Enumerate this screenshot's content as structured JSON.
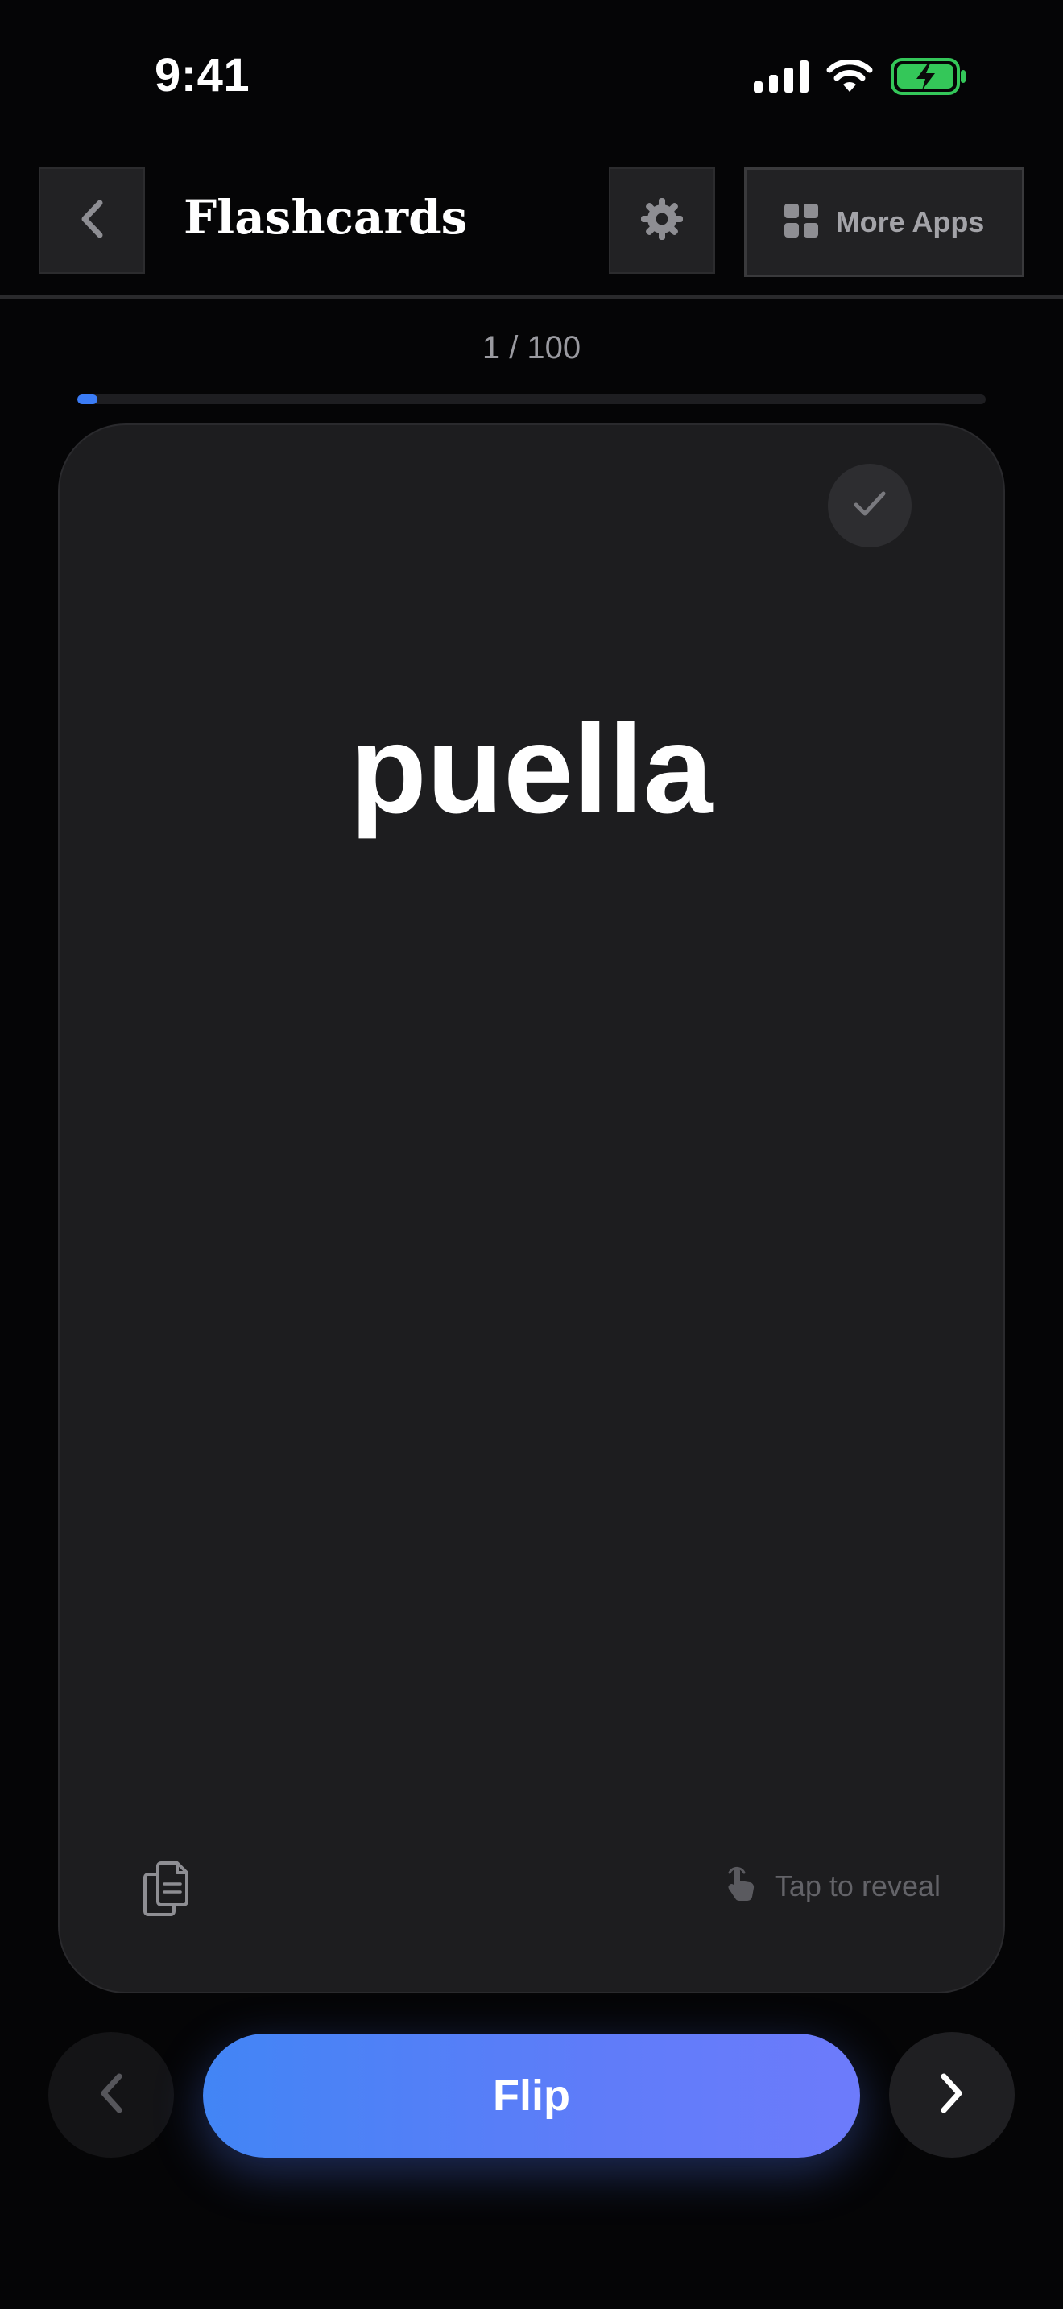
{
  "status_bar": {
    "time": "9:41",
    "icons": [
      "cellular-signal-icon",
      "wifi-icon",
      "battery-charging-icon"
    ],
    "battery_color": "#34c759"
  },
  "header": {
    "back_icon": "chevron-left-icon",
    "title": "Flashcards",
    "settings_icon": "gear-icon",
    "more_apps": {
      "icon": "grid-icon",
      "label": "More Apps"
    }
  },
  "progress": {
    "label": "1 / 100",
    "current": 1,
    "total": 100,
    "accent": "#3b7cf6"
  },
  "card": {
    "known_icon": "checkmark-icon",
    "word": "puella",
    "copy_icon": "copy-documents-icon",
    "hint_icon": "tap-hand-icon",
    "hint_text": "Tap to reveal"
  },
  "controls": {
    "prev_icon": "chevron-left-icon",
    "flip_label": "Flip",
    "next_icon": "chevron-right-icon",
    "flip_gradient": [
      "#4285f5",
      "#6d7bfb"
    ]
  }
}
